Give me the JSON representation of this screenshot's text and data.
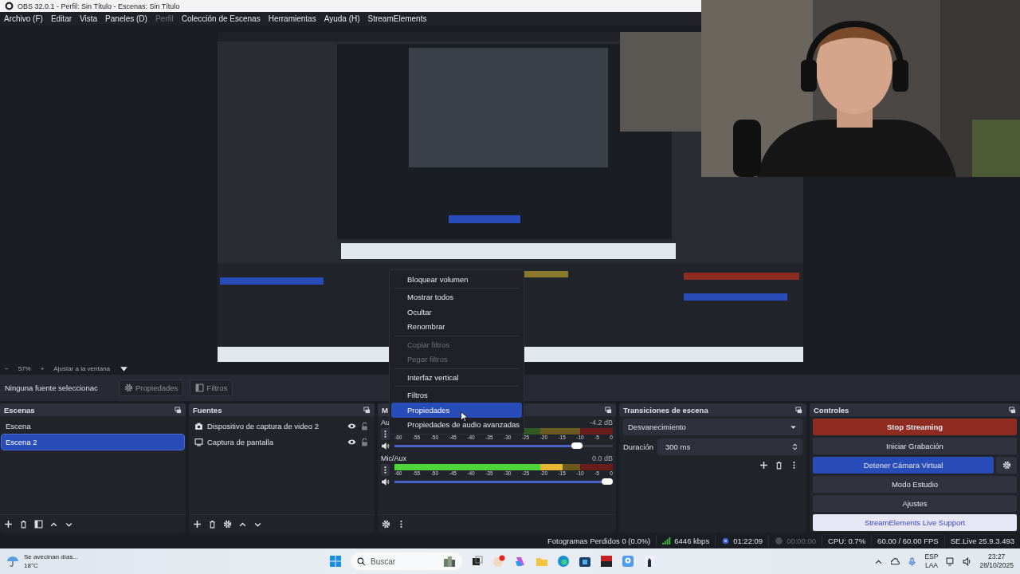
{
  "title_bar": {
    "title": "OBS 32.0.1 - Perfil: Sin Título - Escenas: Sin Título"
  },
  "menu": [
    {
      "label": "Archivo (F)",
      "disabled": false
    },
    {
      "label": "Editar",
      "disabled": false
    },
    {
      "label": "Vista",
      "disabled": false
    },
    {
      "label": "Paneles (D)",
      "disabled": false
    },
    {
      "label": "Perfil",
      "disabled": true
    },
    {
      "label": "Colección de Escenas",
      "disabled": false
    },
    {
      "label": "Herramientas",
      "disabled": false
    },
    {
      "label": "Ayuda (H)",
      "disabled": false
    },
    {
      "label": "StreamElements",
      "disabled": false
    }
  ],
  "zoom_bar": {
    "zoom_out": "−",
    "zoom": "57%",
    "zoom_in": "+",
    "fit": "Ajustar a la ventana"
  },
  "source_bar": {
    "status": "Ninguna fuente seleccionac",
    "buttons": [
      {
        "label": "Propiedades",
        "kind": "gear"
      },
      {
        "label": "Filtros",
        "kind": "filter"
      }
    ]
  },
  "scenes": {
    "title": "Escenas",
    "items": [
      {
        "label": "Escena",
        "selected": false
      },
      {
        "label": "Escena 2",
        "selected": true
      }
    ]
  },
  "sources": {
    "title": "Fuentes",
    "items": [
      {
        "label": "Dispositivo de captura de video 2",
        "kind": "camera"
      },
      {
        "label": "Captura de pantalla",
        "kind": "display"
      }
    ]
  },
  "mixer": {
    "title": "M",
    "channels": [
      {
        "name": "Au",
        "reading": "-4.2 dB",
        "volume": {
          "level": 0.86
        },
        "scale": [
          "-60",
          "-55",
          "-50",
          "-45",
          "-40",
          "-35",
          "-30",
          "-25",
          "-20",
          "-15",
          "-10",
          "-5",
          "0"
        ]
      },
      {
        "name": "Mic/Aux",
        "reading": "0.0 dB",
        "meter": {
          "level": 0.77
        },
        "volume": {
          "level": 1
        },
        "scale": [
          "-60",
          "-55",
          "-50",
          "-45",
          "-40",
          "-35",
          "-30",
          "-25",
          "-20",
          "-15",
          "-10",
          "-5",
          "0"
        ]
      }
    ]
  },
  "transitions": {
    "title": "Transiciones de escena",
    "selected": "Desvanecimiento",
    "duration_label": "Duración",
    "duration": "300 ms"
  },
  "controls": {
    "title": "Controles",
    "buttons": [
      {
        "label": "Stop Streaming",
        "kind": "stop"
      },
      {
        "label": "Iniciar Grabación",
        "kind": "plain"
      },
      {
        "label": "Detener Cámara Virtual",
        "kind": "active"
      },
      {
        "label": "Modo Estudio",
        "kind": "plain"
      },
      {
        "label": "Ajustes",
        "kind": "plain"
      },
      {
        "label": "StreamElements Live Support",
        "kind": "support"
      }
    ]
  },
  "status_bar": {
    "dropped": "Fotogramas Perdidos 0 (0.0%)",
    "bitrate": "6446 kbps",
    "stream_time": "01:22:09",
    "record_time": "00:00:00",
    "cpu": "CPU: 0.7%",
    "fps": "60.00 / 60.00 FPS",
    "version": "SE.Live 25.9.3.493"
  },
  "context_menu": {
    "items": [
      {
        "kind": "item",
        "label": "Bloquear volumen",
        "disabled": false,
        "selected": false
      },
      {
        "kind": "separator"
      },
      {
        "kind": "item",
        "label": "Mostrar todos",
        "disabled": false,
        "selected": false
      },
      {
        "kind": "item",
        "label": "Ocultar",
        "disabled": false,
        "selected": false
      },
      {
        "kind": "item",
        "label": "Renombrar",
        "disabled": false,
        "selected": false
      },
      {
        "kind": "separator"
      },
      {
        "kind": "item",
        "label": "Copiar filtros",
        "disabled": true,
        "selected": false
      },
      {
        "kind": "item",
        "label": "Pegar filtros",
        "disabled": true,
        "selected": false
      },
      {
        "kind": "separator"
      },
      {
        "kind": "item",
        "label": "Interfaz vertical",
        "disabled": false,
        "selected": false
      },
      {
        "kind": "separator"
      },
      {
        "kind": "item",
        "label": "Filtros",
        "disabled": false,
        "selected": false
      },
      {
        "kind": "item",
        "label": "Propiedades",
        "disabled": false,
        "selected": true
      },
      {
        "kind": "item",
        "label": "Propiedades de audio avanzadas",
        "disabled": false,
        "selected": false
      }
    ]
  },
  "taskbar": {
    "weather": "Se avecinan días...",
    "temperature": "18°C",
    "search": {
      "placeholder": "Buscar"
    },
    "language": "ESP",
    "layout": "LAA",
    "time": "23:27",
    "date": "28/10/2025"
  }
}
